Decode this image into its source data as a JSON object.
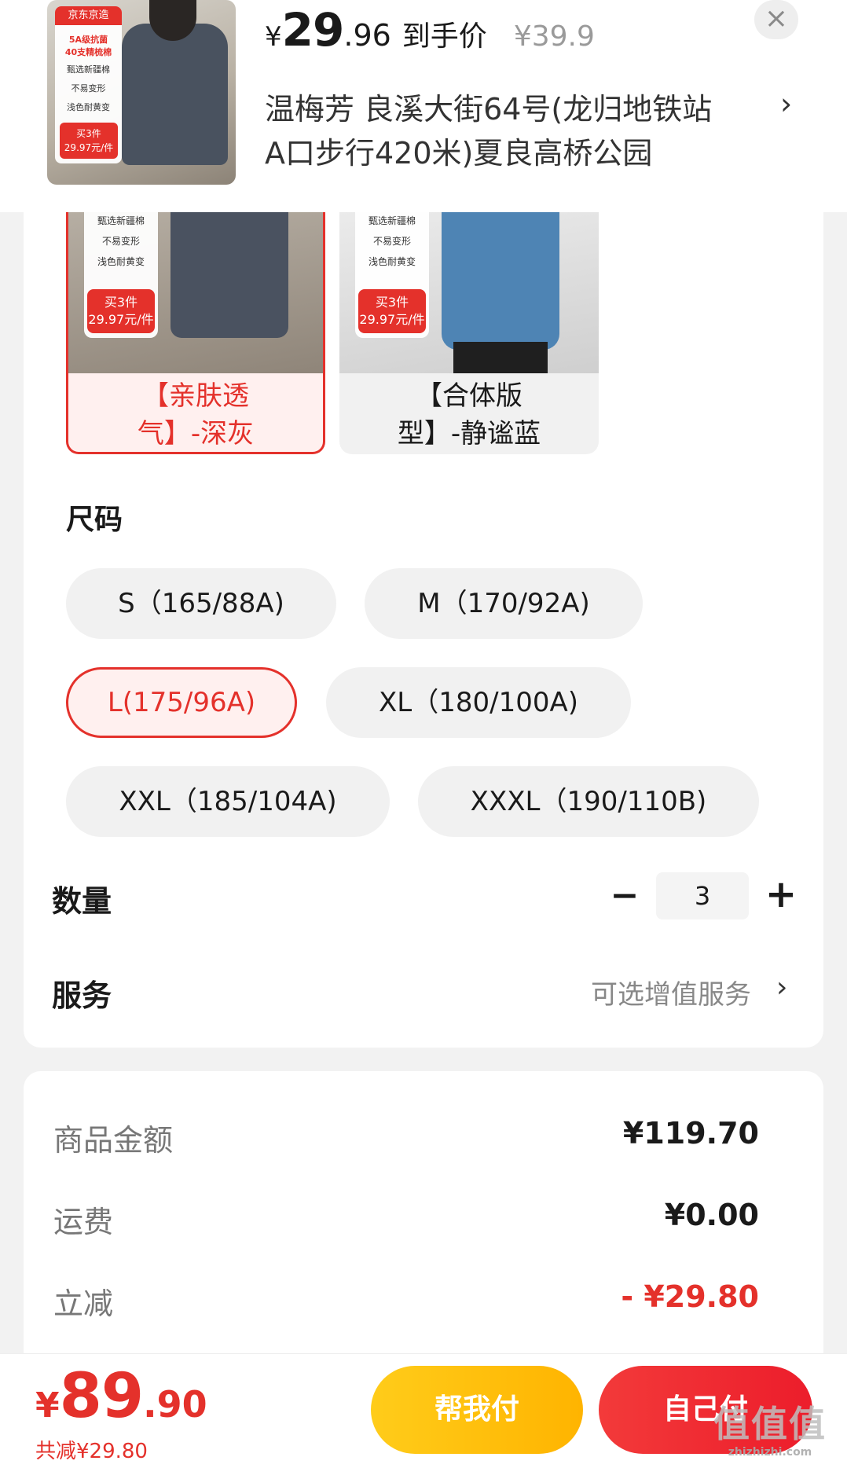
{
  "header": {
    "thumbnail_badge": {
      "brand": "京东京造",
      "lines": [
        "5A级抗菌",
        "40支精梳棉",
        "甄选新疆棉",
        "不易变形",
        "浅色耐黄变"
      ],
      "promo_line1": "买3件",
      "promo_line2": "29.97元/件"
    },
    "price": {
      "currency": "¥",
      "integer": "29",
      "decimal": ".96",
      "tag": "到手价",
      "original": "¥39.9"
    },
    "close_icon": "×",
    "address_line1": "温梅芳  良溪大街64号(龙归地铁站",
    "address_line2": "A口步行420米)夏良高桥公园",
    "address_chevron": "›"
  },
  "variants": [
    {
      "label_line1": "【亲肤透",
      "label_line2": "气】-深灰",
      "selected": true,
      "badge_lines": [
        "甄选新疆棉",
        "不易变形",
        "浅色耐黄变"
      ],
      "promo_line1": "买3件",
      "promo_line2": "29.97元/件"
    },
    {
      "label_line1": "【合体版",
      "label_line2": "型】-静谧蓝",
      "selected": false,
      "badge_lines": [
        "甄选新疆棉",
        "不易变形",
        "浅色耐黄变"
      ],
      "promo_line1": "买3件",
      "promo_line2": "29.97元/件"
    }
  ],
  "size_section": {
    "title": "尺码",
    "options": [
      {
        "label": "S（165/88A)",
        "selected": false
      },
      {
        "label": "M（170/92A)",
        "selected": false
      },
      {
        "label": "L(175/96A)",
        "selected": true
      },
      {
        "label": "XL（180/100A)",
        "selected": false
      },
      {
        "label": "XXL（185/104A)",
        "selected": false
      },
      {
        "label": "XXXL（190/110B)",
        "selected": false
      }
    ]
  },
  "quantity": {
    "title": "数量",
    "minus": "−",
    "value": "3",
    "plus": "+"
  },
  "service": {
    "title": "服务",
    "hint": "可选增值服务",
    "chevron": "›"
  },
  "summary": {
    "rows": [
      {
        "label": "商品金额",
        "value": "¥119.70"
      },
      {
        "label": "运费",
        "value": "¥0.00"
      },
      {
        "label": "立减",
        "value": "- ¥29.80"
      }
    ]
  },
  "bottom": {
    "total_currency": "¥",
    "total_integer": "89",
    "total_decimal": ".90",
    "total_discount": "共减¥29.80",
    "help_pay_button": "帮我付",
    "self_pay_button": "自己付"
  },
  "watermark": {
    "main": "值值值",
    "sub": "zhizhizhi.com"
  },
  "colors": {
    "accent_red": "#e4312b",
    "help_yellow": "#ffc107",
    "background": "#f2f2f2"
  }
}
